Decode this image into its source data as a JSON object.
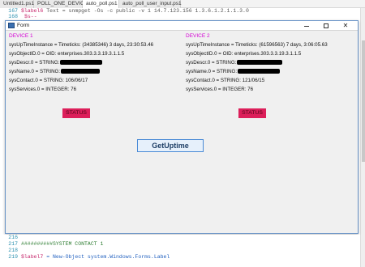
{
  "tabs": [
    {
      "label": "Untitled1.ps1*"
    },
    {
      "label": "POLL_ONE_DEVICE.ps1"
    },
    {
      "label": "auto_poll.ps1"
    },
    {
      "label": "auto_poll_user_input.ps1"
    }
  ],
  "editor_top": {
    "line1_num": "167",
    "line1_var": "$label6",
    "line1_text": " Text = snmpget -Os -c public -v 1 14.7.123.156 1.3.6.1.2.1.1.3.0",
    "line2_num": "168",
    "line2_text": "$s--"
  },
  "window": {
    "title": "Form",
    "minimize": "–",
    "maximize": "□",
    "close": "✕"
  },
  "device1": {
    "heading": "DEVICE 1",
    "uptime": "sysUpTimeInstance = Timeticks: (34385346) 3 days, 23:30:53.46",
    "objectid": "sysObjectID.0 = OID: enterprises.303.3.3.19.3.1.1.5",
    "descr": "sysDescr.0 = STRING:",
    "name": "sysName.0 = STRING:",
    "contact": "sysContact.0 = STRING: 106/06/17",
    "services": "sysServices.0 = INTEGER: 76",
    "status": "STATUS"
  },
  "device2": {
    "heading": "DEVICE 2",
    "uptime": "sysUpTimeInstance = Timeticks: (61596563) 7 days, 3:06:05.63",
    "objectid": "sysObjectID.0 = OID: enterprises.303.3.3.19.3.1.1.5",
    "descr": "sysDescr.0 = STRING:",
    "name": "sysName.0 = STRING:",
    "contact": "sysContact.0 = STRING: 121/06/15",
    "services": "sysServices.0 = INTEGER: 76",
    "status": "STATUS"
  },
  "button": {
    "label": "GetUptime"
  },
  "editor_bottom": {
    "line1_num": "216",
    "line1_text": "",
    "line2_num": "217",
    "line2_text": "##########SYSTEM CONTACT 1",
    "line3_num": "218",
    "line3_text": "",
    "line4_num": "219",
    "line4_var": "$label7",
    "line4_text": " = New-Object system.Windows.Forms.Label"
  },
  "colors": {
    "device_heading": "#d400d4",
    "status_bg": "#dc1f5a",
    "button_border": "#4a8ad6"
  }
}
